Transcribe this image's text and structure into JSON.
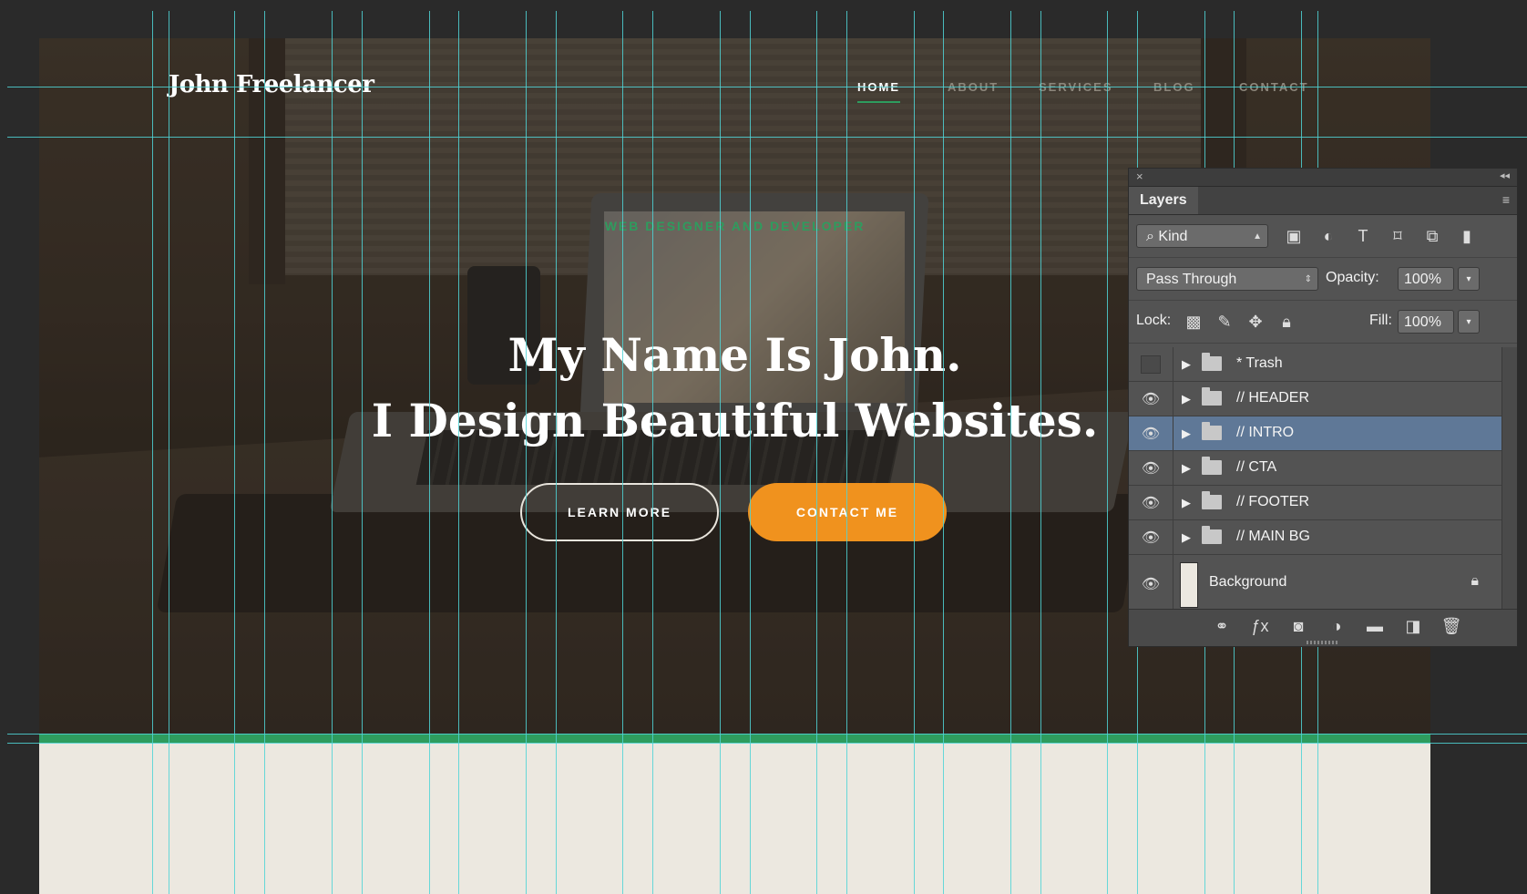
{
  "site": {
    "logo": "John Freelancer",
    "nav": [
      {
        "label": "HOME",
        "active": true
      },
      {
        "label": "ABOUT",
        "active": false
      },
      {
        "label": "SERVICES",
        "active": false
      },
      {
        "label": "BLOG",
        "active": false
      },
      {
        "label": "CONTACT",
        "active": false
      }
    ],
    "eyebrow": "WEB DESIGNER AND DEVELOPER",
    "headline_line1": "My Name Is John.",
    "headline_line2": "I Design Beautiful Websites.",
    "btn_learn_more": "LEARN MORE",
    "btn_contact_me": "CONTACT ME",
    "accent_color": "#2e9c5e",
    "cta_color": "#f0921e"
  },
  "layers_panel": {
    "close_glyph": "×",
    "collapse_glyph": "◂◂",
    "tab_label": "Layers",
    "menu_glyph": "≡",
    "filter_label": "Kind",
    "blend_mode": "Pass Through",
    "opacity_label": "Opacity:",
    "opacity_value": "100%",
    "lock_label": "Lock:",
    "fill_label": "Fill:",
    "fill_value": "100%",
    "layers": [
      {
        "name": "* Trash",
        "visible": false,
        "type": "folder"
      },
      {
        "name": "// HEADER",
        "visible": true,
        "type": "folder"
      },
      {
        "name": "// INTRO",
        "visible": true,
        "type": "folder",
        "selected": true
      },
      {
        "name": "// CTA",
        "visible": true,
        "type": "folder"
      },
      {
        "name": "// FOOTER",
        "visible": true,
        "type": "folder"
      },
      {
        "name": "// MAIN BG",
        "visible": true,
        "type": "folder"
      },
      {
        "name": "Background",
        "visible": true,
        "type": "background",
        "locked": true
      }
    ],
    "selected_color": "#5f7897"
  }
}
